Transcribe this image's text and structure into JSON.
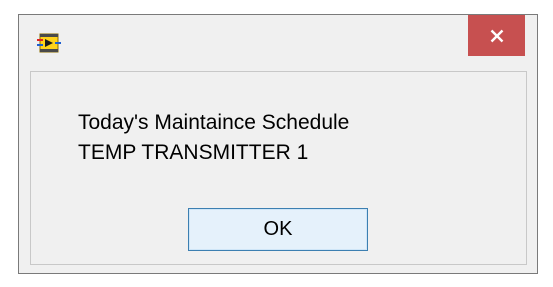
{
  "dialog": {
    "app_icon": "labview-vi-icon",
    "close_icon": "close-icon",
    "message_line1": "Today's Maintaince Schedule",
    "message_line2": "TEMP TRANSMITTER 1",
    "ok_label": "OK"
  },
  "colors": {
    "close_button_bg": "#c75050",
    "window_bg": "#f0f0f0",
    "ok_border": "#3c7fb1",
    "ok_bg": "#e5f1fb"
  }
}
